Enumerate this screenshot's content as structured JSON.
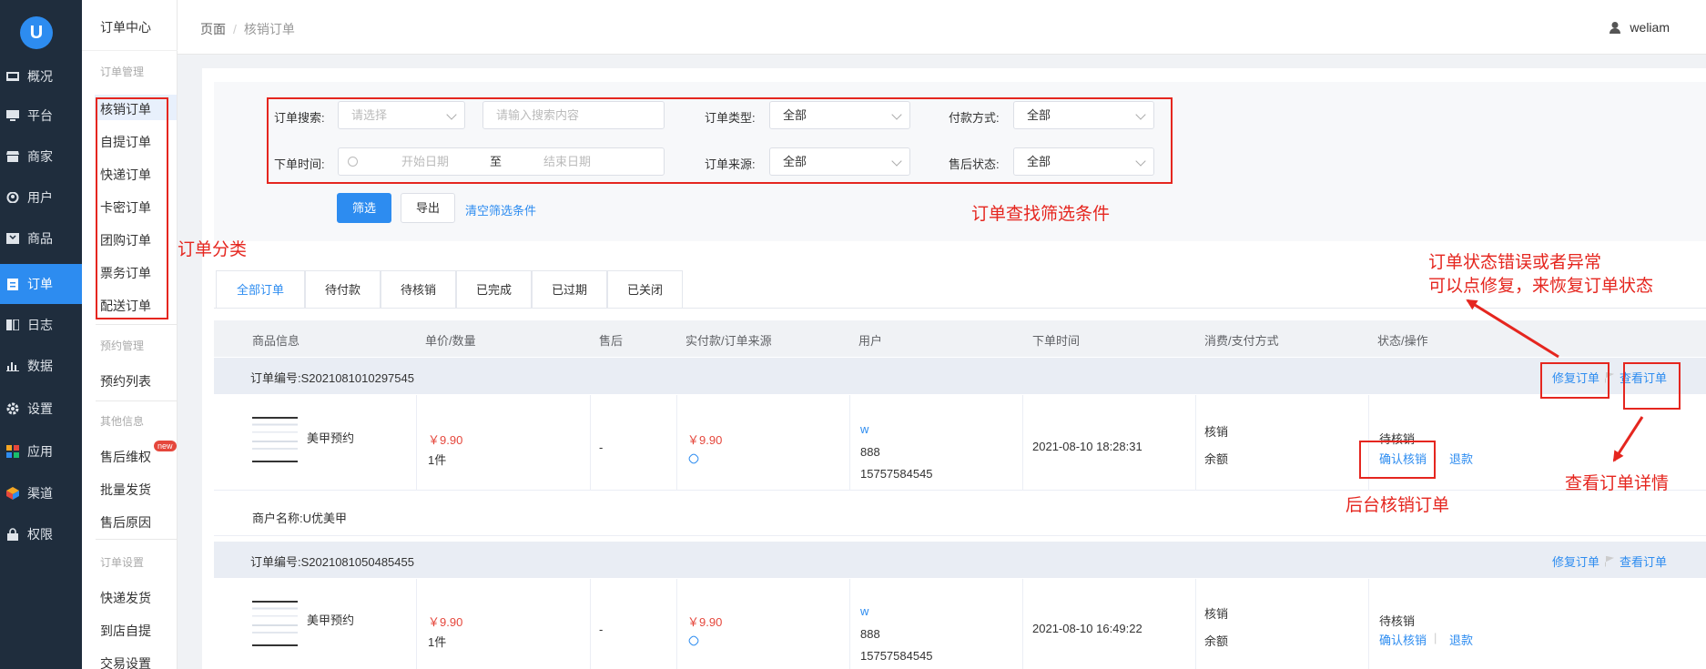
{
  "sidebar": {
    "logo": "U",
    "items": [
      {
        "label": "概况",
        "icon": "overview-icon"
      },
      {
        "label": "平台",
        "icon": "monitor-icon"
      },
      {
        "label": "商家",
        "icon": "store-icon"
      },
      {
        "label": "用户",
        "icon": "user-icon"
      },
      {
        "label": "商品",
        "icon": "goods-icon"
      },
      {
        "label": "订单",
        "icon": "order-icon"
      },
      {
        "label": "日志",
        "icon": "log-icon"
      },
      {
        "label": "数据",
        "icon": "chart-icon"
      },
      {
        "label": "设置",
        "icon": "gear-icon"
      },
      {
        "label": "应用",
        "icon": "apps-icon"
      },
      {
        "label": "渠道",
        "icon": "channel-icon"
      },
      {
        "label": "权限",
        "icon": "lock-icon"
      }
    ],
    "active_index": 5
  },
  "submenu": {
    "title": "订单中心",
    "group1": "订单管理",
    "items1": [
      "核销订单",
      "自提订单",
      "快递订单",
      "卡密订单",
      "团购订单",
      "票务订单",
      "配送订单"
    ],
    "group2": "预约管理",
    "items2": [
      "预约列表"
    ],
    "group3": "其他信息",
    "items3": [
      "售后维权",
      "批量发货",
      "售后原因"
    ],
    "new_badge": "new",
    "group4": "订单设置",
    "items4": [
      "快递发货",
      "到店自提",
      "交易设置"
    ]
  },
  "header": {
    "breadcrumb_root": "页面",
    "breadcrumb_sep": "/",
    "breadcrumb_current": "核销订单",
    "username": "weliam"
  },
  "filter": {
    "search_label": "订单搜索:",
    "search_select_placeholder": "请选择",
    "search_input_placeholder": "请输入搜索内容",
    "type_label": "订单类型:",
    "type_value": "全部",
    "pay_label": "付款方式:",
    "pay_value": "全部",
    "time_label": "下单时间:",
    "start_placeholder": "开始日期",
    "range_sep": "至",
    "end_placeholder": "结束日期",
    "source_label": "订单来源:",
    "source_value": "全部",
    "after_label": "售后状态:",
    "after_value": "全部",
    "filter_button": "筛选",
    "export_button": "导出",
    "clear_link": "清空筛选条件"
  },
  "tabs": [
    "全部订单",
    "待付款",
    "待核销",
    "已完成",
    "已过期",
    "已关闭"
  ],
  "table": {
    "headers": [
      "商品信息",
      "单价/数量",
      "售后",
      "实付款/订单来源",
      "用户",
      "下单时间",
      "消费/支付方式",
      "状态/操作"
    ],
    "repair_label": "修复订单",
    "view_label": "查看订单",
    "orders": [
      {
        "order_no": "订单编号:S2021081010297545",
        "product": "美甲预约",
        "price": "￥9.90",
        "qty": "1件",
        "after_sale": "-",
        "paid": "￥9.90",
        "user_name": "w",
        "user_id": "888",
        "phone": "15757584545",
        "time": "2021-08-10 18:28:31",
        "consume": "核销",
        "pay_method": "余额",
        "status": "待核销",
        "confirm": "确认核销",
        "refund": "退款",
        "merchant": "商户名称:U优美甲"
      },
      {
        "order_no": "订单编号:S2021081050485455",
        "product": "美甲预约",
        "price": "￥9.90",
        "qty": "1件",
        "after_sale": "-",
        "paid": "￥9.90",
        "user_name": "w",
        "user_id": "888",
        "phone": "15757584545",
        "time": "2021-08-10 16:49:22",
        "consume": "核销",
        "pay_method": "余额",
        "status": "待核销",
        "confirm": "确认核销",
        "refund": "退款"
      }
    ]
  },
  "annotations": {
    "category": "订单分类",
    "filter": "订单查找筛选条件",
    "repair_line1": "订单状态错误或者异常",
    "repair_line2": "可以点修复，来恢复订单状态",
    "backend": "后台核销订单",
    "detail": "查看订单详情"
  },
  "colors": {
    "accent": "#2d8cf0",
    "sidebar_bg": "#1f2d3d",
    "annotation_red": "#e5261f",
    "price_red": "#e5473c"
  }
}
